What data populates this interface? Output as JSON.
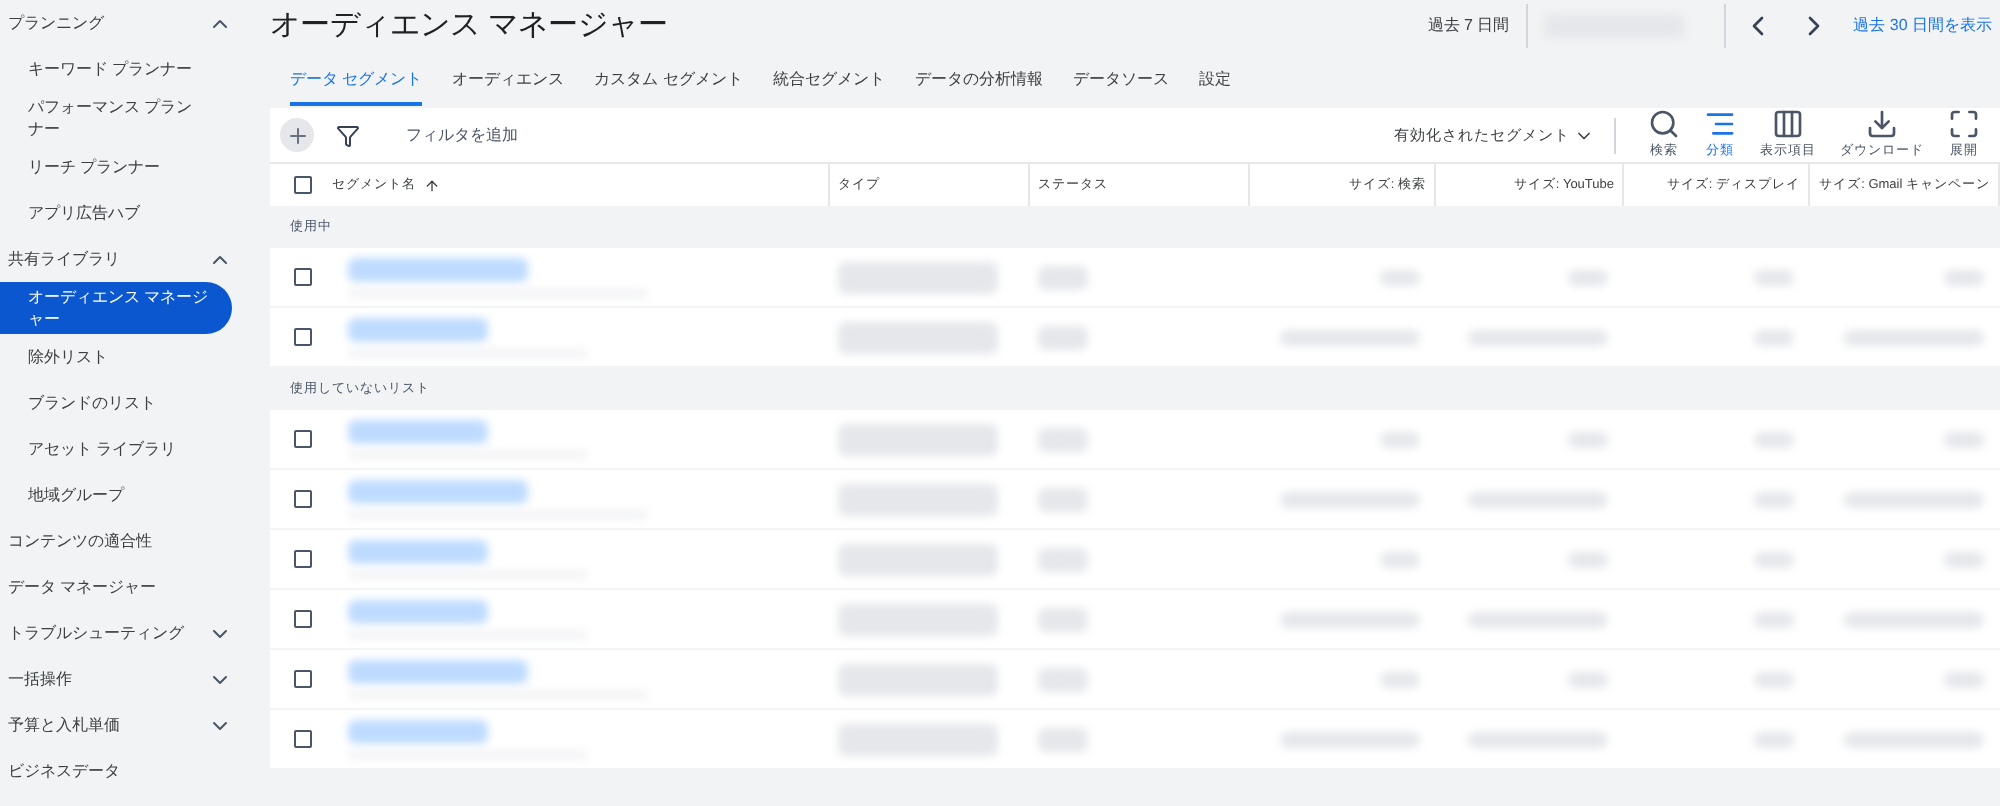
{
  "sidebar": {
    "sections": [
      {
        "label": "プランニング",
        "expanded": true,
        "children": [
          {
            "label": "キーワード プランナー",
            "selected": false
          },
          {
            "label": "パフォーマンス プランナー",
            "selected": false
          },
          {
            "label": "リーチ プランナー",
            "selected": false
          },
          {
            "label": "アプリ広告ハブ",
            "selected": false
          }
        ]
      },
      {
        "label": "共有ライブラリ",
        "expanded": true,
        "children": [
          {
            "label": "オーディエンス マネージャー",
            "selected": true
          },
          {
            "label": "除外リスト",
            "selected": false
          },
          {
            "label": "ブランドのリスト",
            "selected": false
          },
          {
            "label": "アセット ライブラリ",
            "selected": false
          },
          {
            "label": "地域グループ",
            "selected": false
          }
        ]
      },
      {
        "label": "コンテンツの適合性"
      },
      {
        "label": "データ マネージャー"
      },
      {
        "label": "トラブルシューティング",
        "expanded": false
      },
      {
        "label": "一括操作",
        "expanded": false
      },
      {
        "label": "予算と入札単価",
        "expanded": false
      },
      {
        "label": "ビジネスデータ"
      }
    ]
  },
  "header": {
    "title": "オーディエンス マネージャー",
    "period_label": "過去 7 日間",
    "link": "過去 30 日間を表示"
  },
  "tabs": [
    {
      "label": "データ セグメント",
      "selected": true
    },
    {
      "label": "オーディエンス",
      "selected": false
    },
    {
      "label": "カスタム セグメント",
      "selected": false
    },
    {
      "label": "統合セグメント",
      "selected": false
    },
    {
      "label": "データの分析情報",
      "selected": false
    },
    {
      "label": "データソース",
      "selected": false
    },
    {
      "label": "設定",
      "selected": false
    }
  ],
  "toolbar": {
    "filter_placeholder": "フィルタを追加",
    "segment_dropdown": "有効化されたセグメント",
    "actions": [
      {
        "kind": "search",
        "label": "検索",
        "selected": false
      },
      {
        "kind": "segment",
        "label": "分類",
        "selected": true
      },
      {
        "kind": "columns",
        "label": "表示項目",
        "selected": false
      },
      {
        "kind": "download",
        "label": "ダウンロード",
        "selected": false
      },
      {
        "kind": "expand",
        "label": "展開",
        "selected": false
      }
    ]
  },
  "table": {
    "select_all_checked": false,
    "columns": [
      "セグメント名",
      "タイプ",
      "ステータス",
      "サイズ: 検索",
      "サイズ: YouTube",
      "サイズ: ディスプレイ",
      "サイズ: Gmail キャンペーン"
    ],
    "groups": [
      {
        "label": "使用中",
        "rows": [
          {
            "checked": false
          },
          {
            "checked": false
          }
        ]
      },
      {
        "label": "使用していないリスト",
        "rows": [
          {
            "checked": false
          },
          {
            "checked": false
          },
          {
            "checked": false
          },
          {
            "checked": false
          },
          {
            "checked": false
          },
          {
            "checked": false
          }
        ]
      }
    ]
  }
}
